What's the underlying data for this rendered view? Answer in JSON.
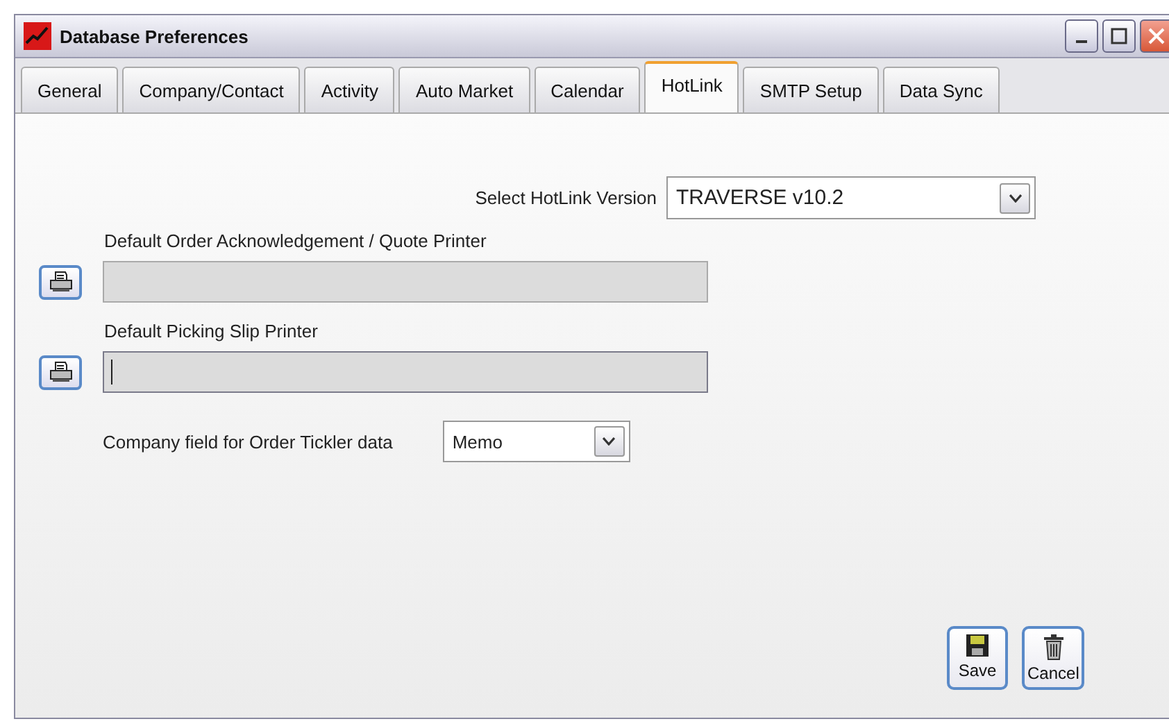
{
  "window": {
    "title": "Database Preferences"
  },
  "tabs": [
    {
      "label": "General",
      "selected": false
    },
    {
      "label": "Company/Contact",
      "selected": false
    },
    {
      "label": "Activity",
      "selected": false
    },
    {
      "label": "Auto Market",
      "selected": false
    },
    {
      "label": "Calendar",
      "selected": false
    },
    {
      "label": "HotLink",
      "selected": true
    },
    {
      "label": "SMTP Setup",
      "selected": false
    },
    {
      "label": "Data Sync",
      "selected": false
    }
  ],
  "hotlink_version": {
    "label": "Select HotLink Version",
    "value": "TRAVERSE v10.2"
  },
  "printers": [
    {
      "label": "Default Order Acknowledgement / Quote Printer",
      "focused": false
    },
    {
      "label": "Default Picking Slip Printer",
      "focused": true
    }
  ],
  "order_tickler": {
    "label": "Company field for Order Tickler data",
    "value": "Memo"
  },
  "buttons": [
    {
      "kind": "save",
      "label": "Save"
    },
    {
      "kind": "cancel",
      "label": "Cancel"
    }
  ]
}
